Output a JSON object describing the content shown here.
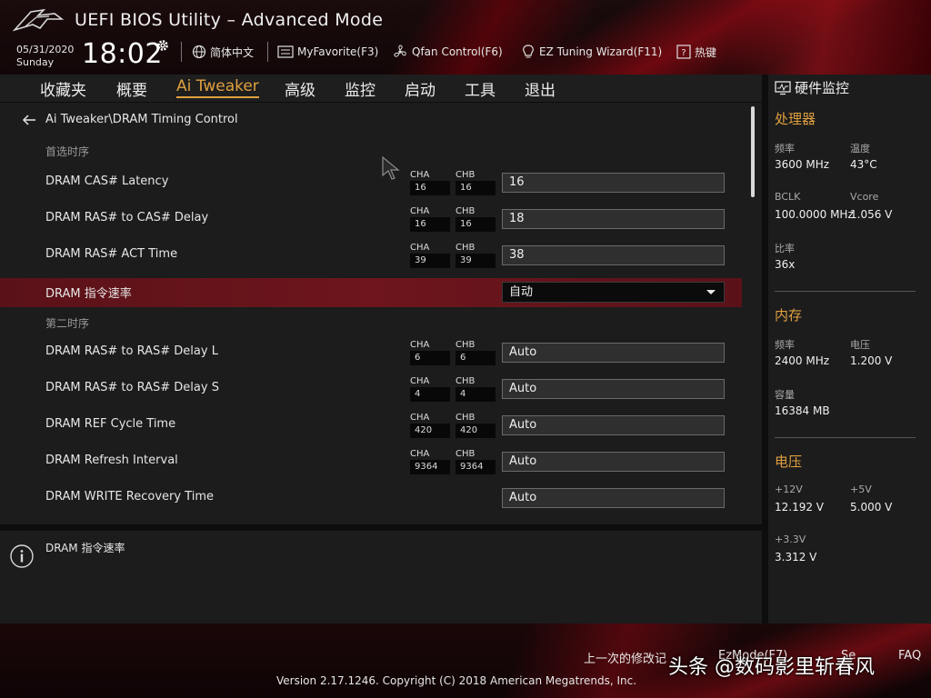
{
  "header": {
    "title": "UEFI BIOS Utility – Advanced Mode",
    "date": "05/31/2020",
    "day": "Sunday",
    "time": "18:02",
    "language": "简体中文",
    "myfavorite": "MyFavorite(F3)",
    "qfan": "Qfan Control(F6)",
    "ez_tuning": "EZ Tuning Wizard(F11)",
    "hotkeys": "热键"
  },
  "nav": {
    "items": [
      {
        "label": "收藏夹"
      },
      {
        "label": "概要"
      },
      {
        "label": "Ai Tweaker"
      },
      {
        "label": "高级"
      },
      {
        "label": "监控"
      },
      {
        "label": "启动"
      },
      {
        "label": "工具"
      },
      {
        "label": "退出"
      }
    ],
    "active_index": 2
  },
  "main": {
    "breadcrumb": "Ai Tweaker\\DRAM Timing Control",
    "section_primary": "首选时序",
    "section_secondary": "第二时序",
    "rows": [
      {
        "label": "DRAM CAS# Latency",
        "cha_label": "CHA",
        "cha": "16",
        "chb_label": "CHB",
        "chb": "16",
        "value": "16"
      },
      {
        "label": "DRAM RAS# to CAS# Delay",
        "cha_label": "CHA",
        "cha": "16",
        "chb_label": "CHB",
        "chb": "16",
        "value": "18"
      },
      {
        "label": "DRAM RAS# ACT Time",
        "cha_label": "CHA",
        "cha": "39",
        "chb_label": "CHB",
        "chb": "39",
        "value": "38"
      },
      {
        "label": "DRAM 指令速率",
        "value": "自动"
      },
      {
        "label": "DRAM RAS# to RAS# Delay L",
        "cha_label": "CHA",
        "cha": "6",
        "chb_label": "CHB",
        "chb": "6",
        "value": "Auto"
      },
      {
        "label": "DRAM RAS# to RAS# Delay S",
        "cha_label": "CHA",
        "cha": "4",
        "chb_label": "CHB",
        "chb": "4",
        "value": "Auto"
      },
      {
        "label": "DRAM REF Cycle Time",
        "cha_label": "CHA",
        "cha": "420",
        "chb_label": "CHB",
        "chb": "420",
        "value": "Auto"
      },
      {
        "label": "DRAM Refresh Interval",
        "cha_label": "CHA",
        "cha": "9364",
        "chb_label": "CHB",
        "chb": "9364",
        "value": "Auto"
      },
      {
        "label": "DRAM WRITE Recovery Time",
        "value": "Auto"
      }
    ]
  },
  "help": {
    "text": "DRAM 指令速率"
  },
  "monitor": {
    "title": "硬件监控",
    "cpu": {
      "title": "处理器",
      "freq_key": "频率",
      "freq": "3600 MHz",
      "temp_key": "温度",
      "temp": "43°C",
      "bclk_key": "BCLK",
      "bclk": "100.0000 MHz",
      "vcore_key": "Vcore",
      "vcore": "1.056 V",
      "ratio_key": "比率",
      "ratio": "36x"
    },
    "memory": {
      "title": "内存",
      "freq_key": "频率",
      "freq": "2400 MHz",
      "volt_key": "电压",
      "volt": "1.200 V",
      "cap_key": "容量",
      "cap": "16384 MB"
    },
    "voltage": {
      "title": "电压",
      "v12_key": "+12V",
      "v12": "12.192 V",
      "v5_key": "+5V",
      "v5": "5.000 V",
      "v33_key": "+3.3V",
      "v33": "3.312 V"
    }
  },
  "footer": {
    "last_modified": "上一次的修改记",
    "ez_mode": "EzMode(F7)",
    "search": "Se",
    "faq": "FAQ",
    "copyright": "Version 2.17.1246. Copyright (C) 2018 American Megatrends, Inc.",
    "watermark": "头条 @数码影里斩春风"
  }
}
